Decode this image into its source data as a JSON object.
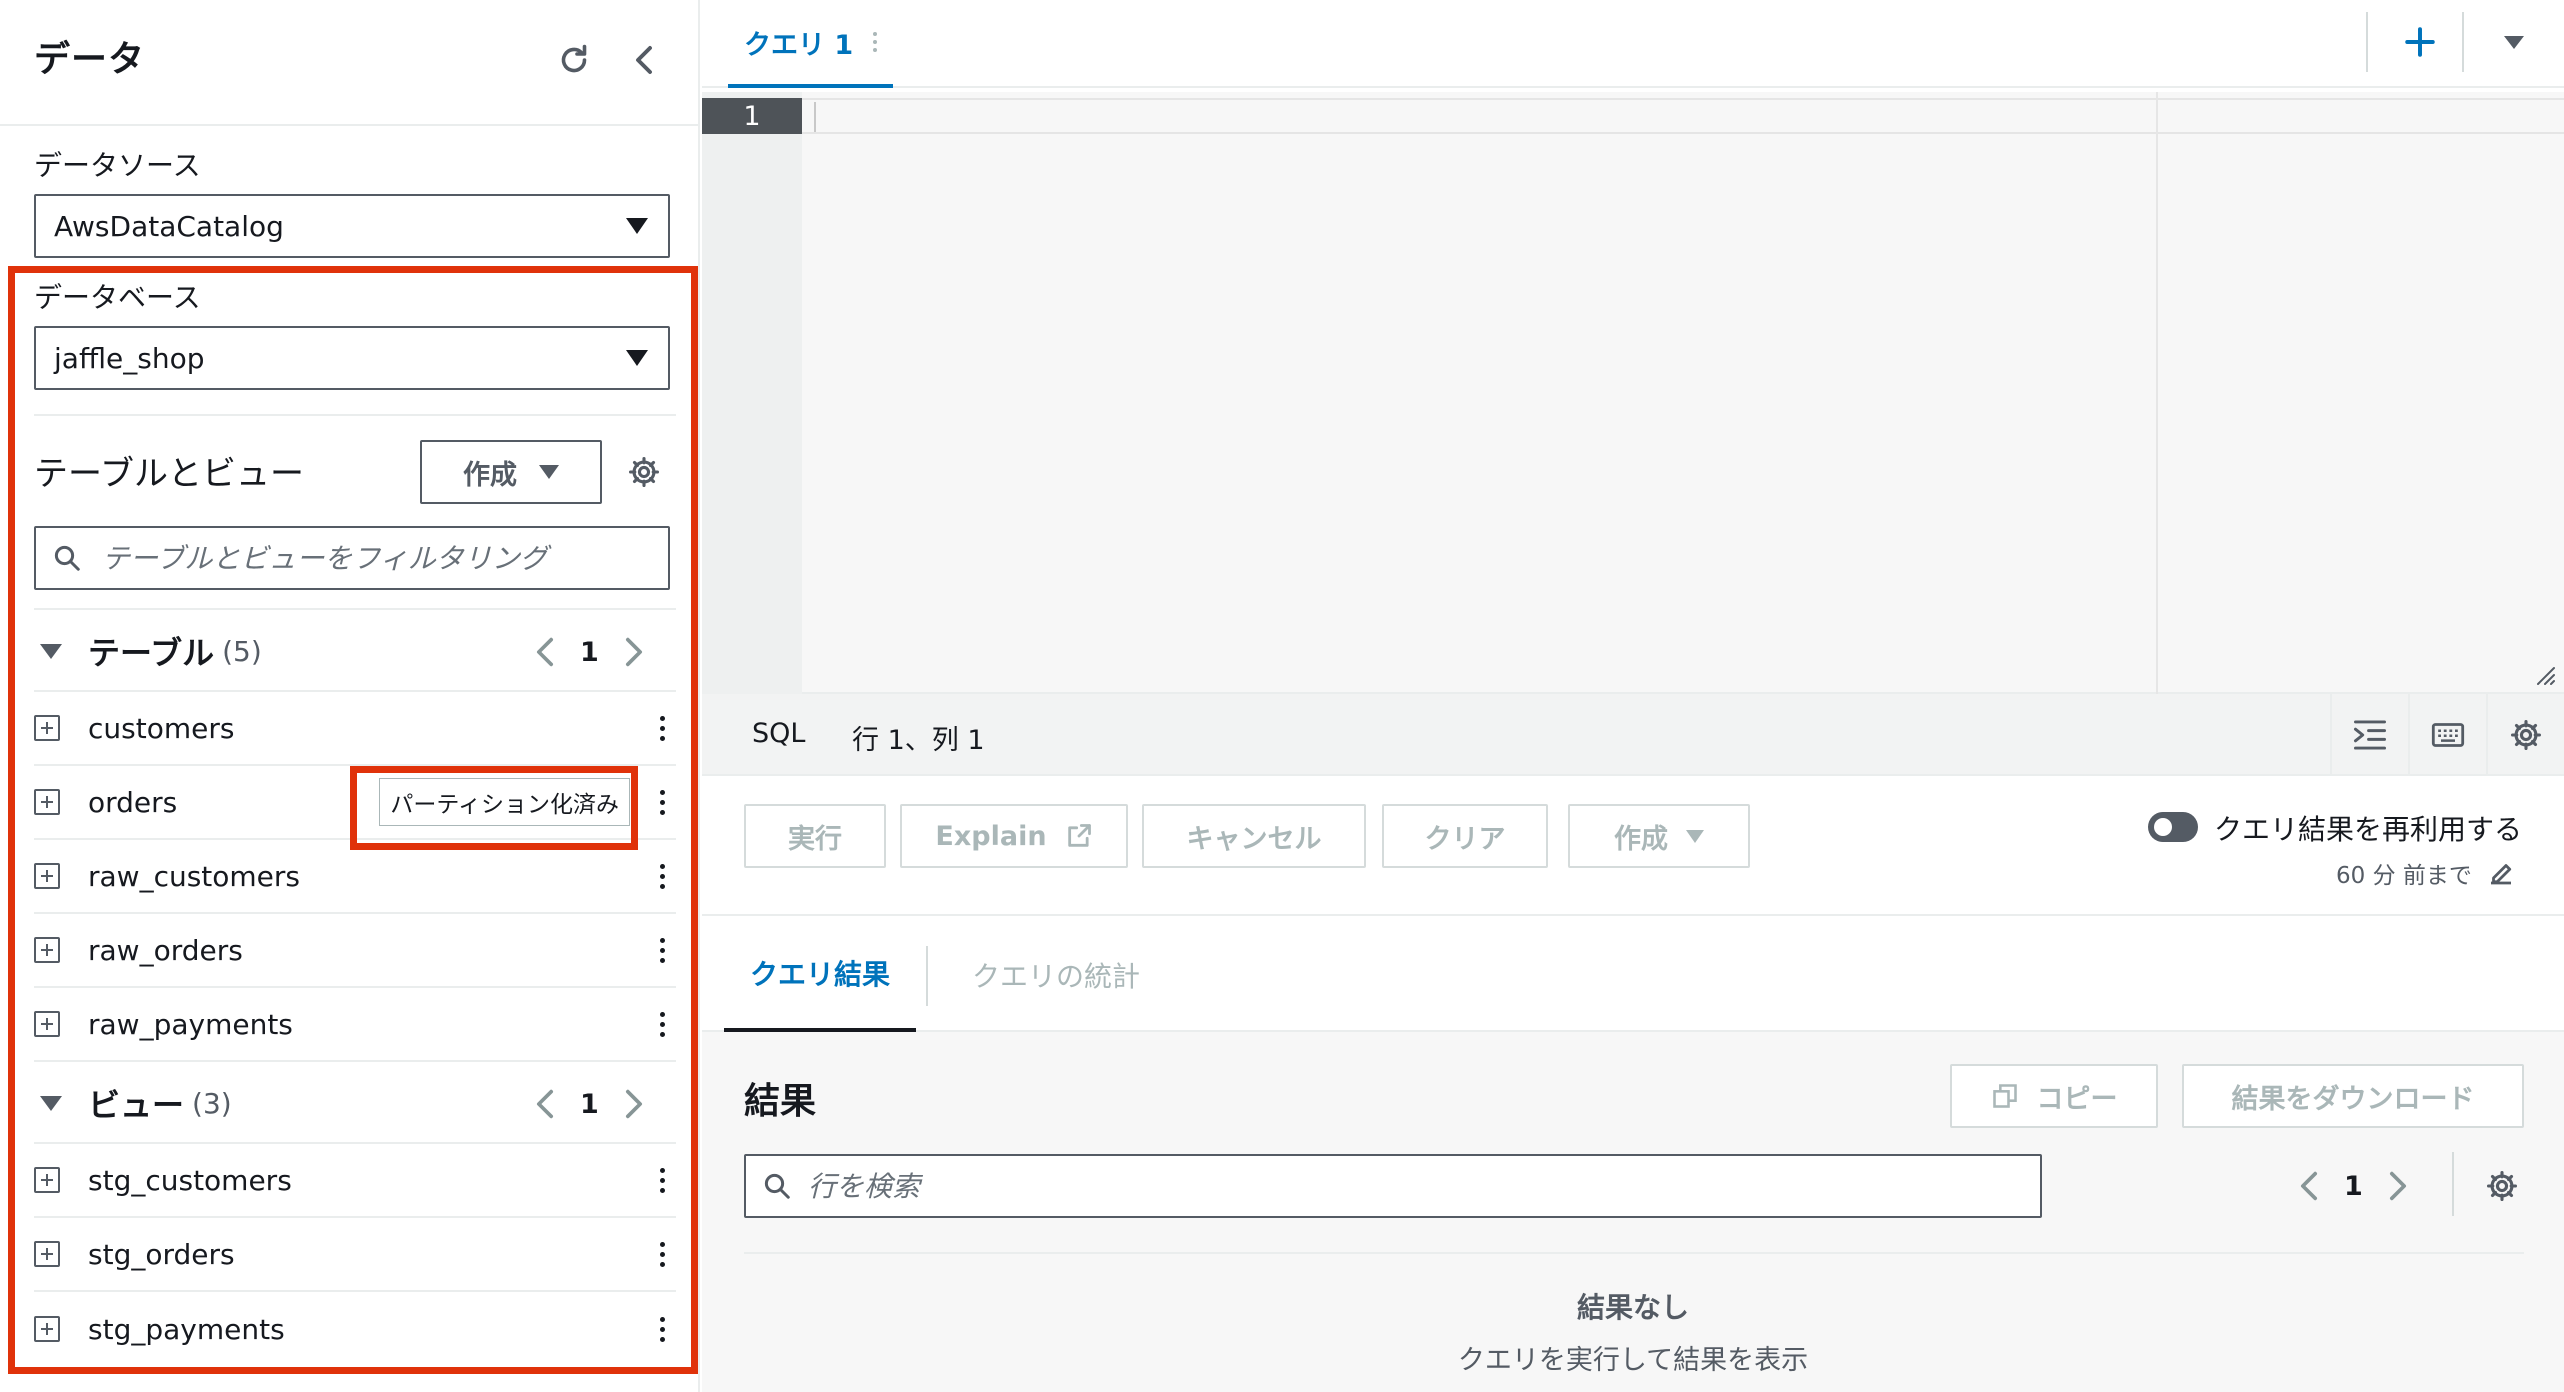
{
  "left": {
    "title": "データ",
    "datasource": {
      "label": "データソース",
      "value": "AwsDataCatalog"
    },
    "database": {
      "label": "データベース",
      "value": "jaffle_shop"
    },
    "tables_views": {
      "title": "テーブルとビュー",
      "create_label": "作成",
      "filter_placeholder": "テーブルとビューをフィルタリング"
    },
    "tables": {
      "name": "テーブル",
      "count": "(5)",
      "page": "1",
      "items": [
        {
          "name": "customers"
        },
        {
          "name": "orders",
          "badge": "パーティション化済み"
        },
        {
          "name": "raw_customers"
        },
        {
          "name": "raw_orders"
        },
        {
          "name": "raw_payments"
        }
      ]
    },
    "views": {
      "name": "ビュー",
      "count": "(3)",
      "page": "1",
      "items": [
        {
          "name": "stg_customers"
        },
        {
          "name": "stg_orders"
        },
        {
          "name": "stg_payments"
        }
      ]
    }
  },
  "editor": {
    "tab_label": "クエリ 1",
    "line_number": "1",
    "status": {
      "language": "SQL",
      "position": "行 1、列 1"
    }
  },
  "actions": {
    "run": "実行",
    "explain": "Explain",
    "cancel": "キャンセル",
    "clear": "クリア",
    "create": "作成",
    "reuse_label": "クエリ結果を再利用する",
    "reuse_sub": "60 分 前まで",
    "reuse_enabled": false
  },
  "results_tabs": {
    "results": "クエリ結果",
    "stats": "クエリの統計"
  },
  "results": {
    "title": "結果",
    "copy": "コピー",
    "download": "結果をダウンロード",
    "search_placeholder": "行を検索",
    "page": "1",
    "empty_title": "結果なし",
    "empty_sub": "クエリを実行して結果を表示"
  },
  "colors": {
    "accent_blue": "#0073bb",
    "highlight_red": "#e0320a",
    "text": "#16191f",
    "disabled": "#aab7b8"
  }
}
